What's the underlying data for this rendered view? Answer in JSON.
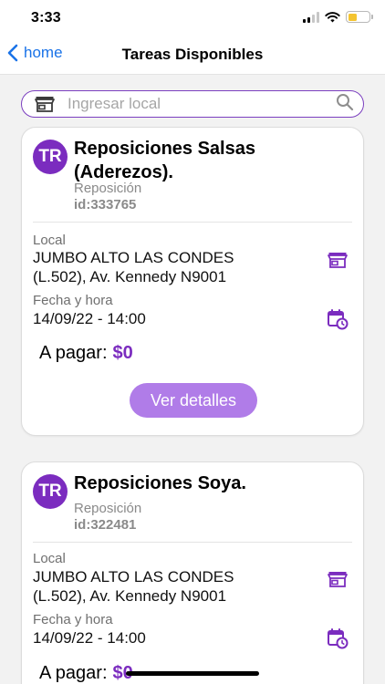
{
  "status_bar": {
    "time": "3:33",
    "signal_bars_on": 2,
    "battery_level": 0.45,
    "battery_color": "#f4c430"
  },
  "nav": {
    "back_label": "home",
    "title": "Tareas Disponibles"
  },
  "search": {
    "placeholder": "Ingresar local",
    "value": ""
  },
  "colors": {
    "accent": "#7b2cbf",
    "button": "#b07ce8",
    "link": "#1a73e8"
  },
  "tasks": [
    {
      "avatar": "TR",
      "title": "Reposiciones Salsas (Aderezos).",
      "type": "Reposición",
      "id": "id:333765",
      "local_label": "Local",
      "local_value": "JUMBO ALTO LAS CONDES (L.502), Av. Kennedy N9001",
      "datetime_label": "Fecha y hora",
      "datetime_value": "14/09/22 - 14:00",
      "pay_label": "A pagar:",
      "pay_amount": "$0",
      "details_label": "Ver detalles"
    },
    {
      "avatar": "TR",
      "title": "Reposiciones Soya.",
      "type": "Reposición",
      "id": "id:322481",
      "local_label": "Local",
      "local_value": "JUMBO ALTO LAS CONDES (L.502), Av. Kennedy N9001",
      "datetime_label": "Fecha y hora",
      "datetime_value": "14/09/22 - 14:00",
      "pay_label": "A pagar:",
      "pay_amount": "$0"
    }
  ],
  "icons": {
    "search": "search-icon",
    "store": "store-icon",
    "calendar": "calendar-clock-icon",
    "back": "chevron-left-icon"
  }
}
